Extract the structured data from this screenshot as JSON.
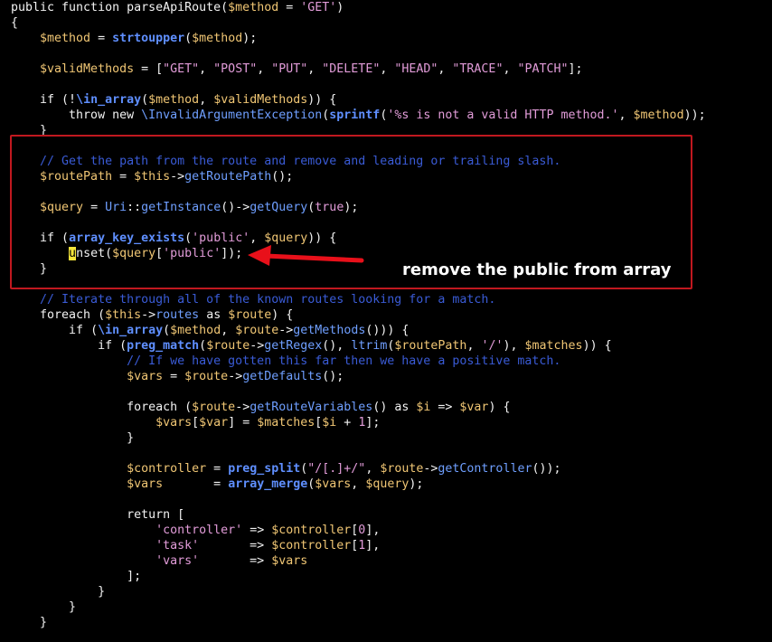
{
  "annotation": {
    "text": "remove the public from array",
    "box_color": "#c0181f",
    "arrow_color": "#e8101a"
  },
  "code_lines": [
    [
      [
        "t-kw",
        "public function "
      ],
      [
        "t-plain",
        "parseApiRoute("
      ],
      [
        "t-var",
        "$method"
      ],
      [
        "t-plain",
        " = "
      ],
      [
        "t-str",
        "'GET'"
      ],
      [
        "t-plain",
        ")"
      ]
    ],
    [
      [
        "t-plain",
        "{"
      ]
    ],
    [
      [
        "t-var",
        "    $method"
      ],
      [
        "t-plain",
        " = "
      ],
      [
        "t-funcb",
        "strtoupper"
      ],
      [
        "t-plain",
        "("
      ],
      [
        "t-var",
        "$method"
      ],
      [
        "t-plain",
        ");"
      ]
    ],
    [],
    [
      [
        "t-var",
        "    $validMethods"
      ],
      [
        "t-plain",
        " = ["
      ],
      [
        "t-str",
        "\"GET\""
      ],
      [
        "t-plain",
        ", "
      ],
      [
        "t-str",
        "\"POST\""
      ],
      [
        "t-plain",
        ", "
      ],
      [
        "t-str",
        "\"PUT\""
      ],
      [
        "t-plain",
        ", "
      ],
      [
        "t-str",
        "\"DELETE\""
      ],
      [
        "t-plain",
        ", "
      ],
      [
        "t-str",
        "\"HEAD\""
      ],
      [
        "t-plain",
        ", "
      ],
      [
        "t-str",
        "\"TRACE\""
      ],
      [
        "t-plain",
        ", "
      ],
      [
        "t-str",
        "\"PATCH\""
      ],
      [
        "t-plain",
        "];"
      ]
    ],
    [],
    [
      [
        "t-kw",
        "    if "
      ],
      [
        "t-plain",
        "(!"
      ],
      [
        "t-funcb",
        "\\in_array"
      ],
      [
        "t-plain",
        "("
      ],
      [
        "t-var",
        "$method"
      ],
      [
        "t-plain",
        ", "
      ],
      [
        "t-var",
        "$validMethods"
      ],
      [
        "t-plain",
        ")) {"
      ]
    ],
    [
      [
        "t-kw",
        "        throw new "
      ],
      [
        "t-class",
        "\\InvalidArgumentException"
      ],
      [
        "t-plain",
        "("
      ],
      [
        "t-funcb",
        "sprintf"
      ],
      [
        "t-plain",
        "("
      ],
      [
        "t-str",
        "'%s is not a valid HTTP method.'"
      ],
      [
        "t-plain",
        ", "
      ],
      [
        "t-var",
        "$method"
      ],
      [
        "t-plain",
        "));"
      ]
    ],
    [
      [
        "t-plain",
        "    }"
      ]
    ],
    [],
    [
      [
        "t-comment",
        "    // Get the path from the route and remove and leading or trailing slash."
      ]
    ],
    [
      [
        "t-var",
        "    $routePath"
      ],
      [
        "t-plain",
        " = "
      ],
      [
        "t-var",
        "$this"
      ],
      [
        "t-plain",
        "->"
      ],
      [
        "t-func",
        "getRoutePath"
      ],
      [
        "t-plain",
        "();"
      ]
    ],
    [],
    [
      [
        "t-var",
        "    $query"
      ],
      [
        "t-plain",
        " = "
      ],
      [
        "t-class",
        "Uri"
      ],
      [
        "t-plain",
        "::"
      ],
      [
        "t-func",
        "getInstance"
      ],
      [
        "t-plain",
        "()->"
      ],
      [
        "t-func",
        "getQuery"
      ],
      [
        "t-plain",
        "("
      ],
      [
        "t-str",
        "true"
      ],
      [
        "t-plain",
        ");"
      ]
    ],
    [],
    [
      [
        "t-kw",
        "    if "
      ],
      [
        "t-plain",
        "("
      ],
      [
        "t-funcb",
        "array_key_exists"
      ],
      [
        "t-plain",
        "("
      ],
      [
        "t-str",
        "'public'"
      ],
      [
        "t-plain",
        ", "
      ],
      [
        "t-var",
        "$query"
      ],
      [
        "t-plain",
        ")) {"
      ]
    ],
    [
      [
        "t-plain",
        "        "
      ],
      [
        "t-cursor",
        "u"
      ],
      [
        "t-plain",
        "nset("
      ],
      [
        "t-var",
        "$query"
      ],
      [
        "t-plain",
        "["
      ],
      [
        "t-str",
        "'public'"
      ],
      [
        "t-plain",
        "]);"
      ]
    ],
    [
      [
        "t-plain",
        "    }"
      ]
    ],
    [],
    [
      [
        "t-comment",
        "    // Iterate through all of the known routes looking for a match."
      ]
    ],
    [
      [
        "t-kw",
        "    foreach "
      ],
      [
        "t-plain",
        "("
      ],
      [
        "t-var",
        "$this"
      ],
      [
        "t-plain",
        "->"
      ],
      [
        "t-func",
        "routes"
      ],
      [
        "t-kw",
        " as "
      ],
      [
        "t-var",
        "$route"
      ],
      [
        "t-plain",
        ") {"
      ]
    ],
    [
      [
        "t-kw",
        "        if "
      ],
      [
        "t-plain",
        "("
      ],
      [
        "t-funcb",
        "\\in_array"
      ],
      [
        "t-plain",
        "("
      ],
      [
        "t-var",
        "$method"
      ],
      [
        "t-plain",
        ", "
      ],
      [
        "t-var",
        "$route"
      ],
      [
        "t-plain",
        "->"
      ],
      [
        "t-func",
        "getMethods"
      ],
      [
        "t-plain",
        "())) {"
      ]
    ],
    [
      [
        "t-kw",
        "            if "
      ],
      [
        "t-plain",
        "("
      ],
      [
        "t-funcb",
        "preg_match"
      ],
      [
        "t-plain",
        "("
      ],
      [
        "t-var",
        "$route"
      ],
      [
        "t-plain",
        "->"
      ],
      [
        "t-func",
        "getRegex"
      ],
      [
        "t-plain",
        "(), "
      ],
      [
        "t-func",
        "ltrim"
      ],
      [
        "t-plain",
        "("
      ],
      [
        "t-var",
        "$routePath"
      ],
      [
        "t-plain",
        ", "
      ],
      [
        "t-str",
        "'/'"
      ],
      [
        "t-plain",
        "), "
      ],
      [
        "t-var",
        "$matches"
      ],
      [
        "t-plain",
        ")) {"
      ]
    ],
    [
      [
        "t-comment",
        "                // If we have gotten this far then we have a positive match."
      ]
    ],
    [
      [
        "t-var",
        "                $vars"
      ],
      [
        "t-plain",
        " = "
      ],
      [
        "t-var",
        "$route"
      ],
      [
        "t-plain",
        "->"
      ],
      [
        "t-func",
        "getDefaults"
      ],
      [
        "t-plain",
        "();"
      ]
    ],
    [],
    [
      [
        "t-kw",
        "                foreach "
      ],
      [
        "t-plain",
        "("
      ],
      [
        "t-var",
        "$route"
      ],
      [
        "t-plain",
        "->"
      ],
      [
        "t-func",
        "getRouteVariables"
      ],
      [
        "t-plain",
        "()"
      ],
      [
        "t-kw",
        " as "
      ],
      [
        "t-var",
        "$i"
      ],
      [
        "t-plain",
        " => "
      ],
      [
        "t-var",
        "$var"
      ],
      [
        "t-plain",
        ") {"
      ]
    ],
    [
      [
        "t-var",
        "                    $vars"
      ],
      [
        "t-plain",
        "["
      ],
      [
        "t-var",
        "$var"
      ],
      [
        "t-plain",
        "] = "
      ],
      [
        "t-var",
        "$matches"
      ],
      [
        "t-plain",
        "["
      ],
      [
        "t-var",
        "$i"
      ],
      [
        "t-plain",
        " + "
      ],
      [
        "t-num",
        "1"
      ],
      [
        "t-plain",
        "];"
      ]
    ],
    [
      [
        "t-plain",
        "                }"
      ]
    ],
    [],
    [
      [
        "t-var",
        "                $controller"
      ],
      [
        "t-plain",
        " = "
      ],
      [
        "t-funcb",
        "preg_split"
      ],
      [
        "t-plain",
        "("
      ],
      [
        "t-str",
        "\"/[.]+/\""
      ],
      [
        "t-plain",
        ", "
      ],
      [
        "t-var",
        "$route"
      ],
      [
        "t-plain",
        "->"
      ],
      [
        "t-func",
        "getController"
      ],
      [
        "t-plain",
        "());"
      ]
    ],
    [
      [
        "t-var",
        "                $vars"
      ],
      [
        "t-plain",
        "       = "
      ],
      [
        "t-funcb",
        "array_merge"
      ],
      [
        "t-plain",
        "("
      ],
      [
        "t-var",
        "$vars"
      ],
      [
        "t-plain",
        ", "
      ],
      [
        "t-var",
        "$query"
      ],
      [
        "t-plain",
        ");"
      ]
    ],
    [],
    [
      [
        "t-kw",
        "                return "
      ],
      [
        "t-plain",
        "["
      ]
    ],
    [
      [
        "t-str",
        "                    'controller'"
      ],
      [
        "t-plain",
        " => "
      ],
      [
        "t-var",
        "$controller"
      ],
      [
        "t-plain",
        "["
      ],
      [
        "t-num",
        "0"
      ],
      [
        "t-plain",
        "],"
      ]
    ],
    [
      [
        "t-str",
        "                    'task'"
      ],
      [
        "t-plain",
        "       => "
      ],
      [
        "t-var",
        "$controller"
      ],
      [
        "t-plain",
        "["
      ],
      [
        "t-num",
        "1"
      ],
      [
        "t-plain",
        "],"
      ]
    ],
    [
      [
        "t-str",
        "                    'vars'"
      ],
      [
        "t-plain",
        "       => "
      ],
      [
        "t-var",
        "$vars"
      ]
    ],
    [
      [
        "t-plain",
        "                ];"
      ]
    ],
    [
      [
        "t-plain",
        "            }"
      ]
    ],
    [
      [
        "t-plain",
        "        }"
      ]
    ],
    [
      [
        "t-plain",
        "    }"
      ]
    ]
  ]
}
